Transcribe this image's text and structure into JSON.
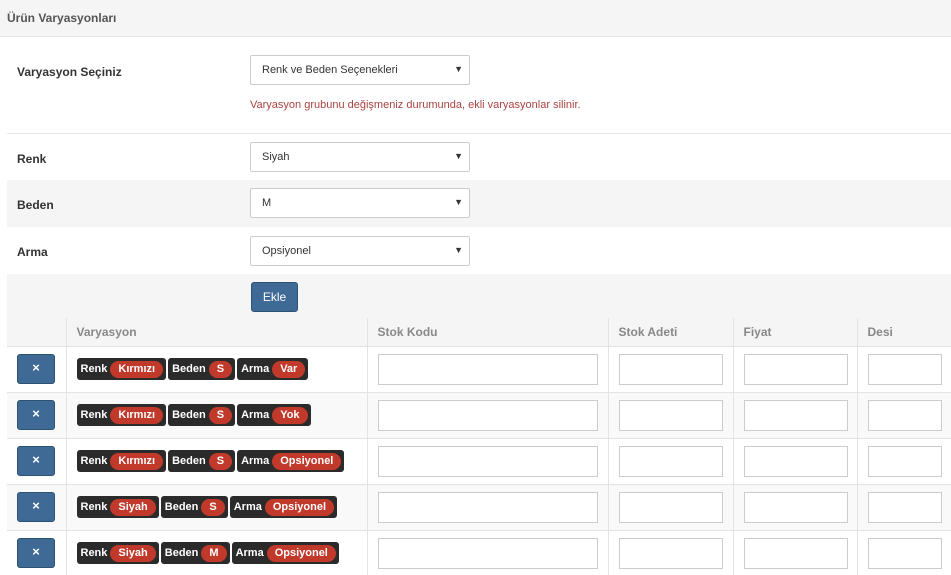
{
  "panel": {
    "title": "Ürün Varyasyonları"
  },
  "variation_select": {
    "label": "Varyasyon Seçiniz",
    "value": "Renk ve Beden Seçenekleri",
    "warning": "Varyasyon grubunu değişmeniz durumunda, ekli varyasyonlar silinir."
  },
  "attributes": [
    {
      "label": "Renk",
      "value": "Siyah"
    },
    {
      "label": "Beden",
      "value": "M"
    },
    {
      "label": "Arma",
      "value": "Opsiyonel"
    }
  ],
  "add_button": "Ekle",
  "table": {
    "headers": [
      "",
      "Varyasyon",
      "Stok Kodu",
      "Stok Adeti",
      "Fiyat",
      "Desi"
    ],
    "delete_symbol": "×",
    "rows": [
      {
        "renk_label": "Renk",
        "renk": "Kırmızı",
        "beden_label": "Beden",
        "beden": "S",
        "arma_label": "Arma",
        "arma": "Var"
      },
      {
        "renk_label": "Renk",
        "renk": "Kırmızı",
        "beden_label": "Beden",
        "beden": "S",
        "arma_label": "Arma",
        "arma": "Yok"
      },
      {
        "renk_label": "Renk",
        "renk": "Kırmızı",
        "beden_label": "Beden",
        "beden": "S",
        "arma_label": "Arma",
        "arma": "Opsiyonel"
      },
      {
        "renk_label": "Renk",
        "renk": "Siyah",
        "beden_label": "Beden",
        "beden": "S",
        "arma_label": "Arma",
        "arma": "Opsiyonel"
      },
      {
        "renk_label": "Renk",
        "renk": "Siyah",
        "beden_label": "Beden",
        "beden": "M",
        "arma_label": "Arma",
        "arma": "Opsiyonel"
      }
    ]
  },
  "colors": {
    "primary": "#3f6a96",
    "pill": "#c0392b",
    "tag": "#2b2b2b",
    "warning": "#a94442"
  }
}
